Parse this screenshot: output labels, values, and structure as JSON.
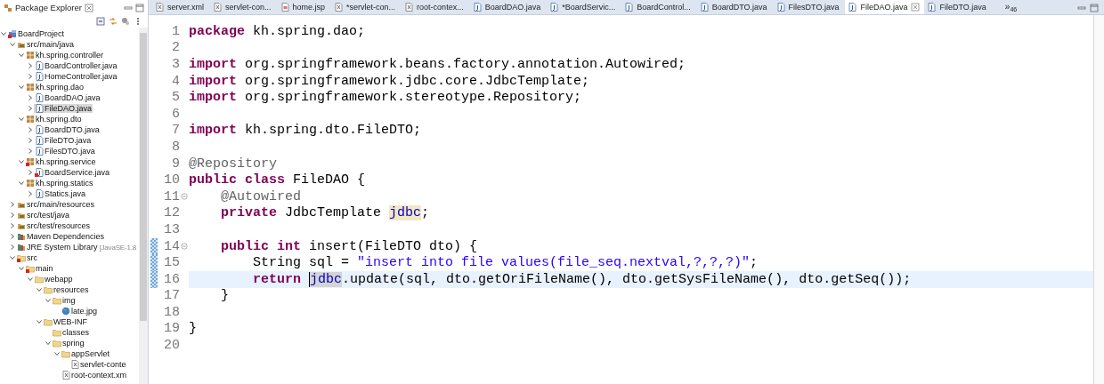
{
  "explorer": {
    "title": "Package Explorer",
    "tree": [
      {
        "label": "BoardProject",
        "kind": "project",
        "error": true,
        "expanded": true,
        "selected": false,
        "children": [
          {
            "label": "src/main/java",
            "kind": "source-folder",
            "error": false,
            "expanded": true,
            "selected": false,
            "children": [
              {
                "label": "kh.spring.controller",
                "kind": "package",
                "error": false,
                "expanded": true,
                "selected": false,
                "children": [
                  {
                    "label": "BoardController.java",
                    "kind": "java",
                    "error": false,
                    "expanded": false,
                    "selected": false
                  },
                  {
                    "label": "HomeController.java",
                    "kind": "java",
                    "error": false,
                    "expanded": false,
                    "selected": false
                  }
                ]
              },
              {
                "label": "kh.spring.dao",
                "kind": "package",
                "error": false,
                "expanded": true,
                "selected": false,
                "children": [
                  {
                    "label": "BoardDAO.java",
                    "kind": "java",
                    "error": false,
                    "expanded": false,
                    "selected": false
                  },
                  {
                    "label": "FileDAO.java",
                    "kind": "java",
                    "error": false,
                    "expanded": false,
                    "selected": true
                  }
                ]
              },
              {
                "label": "kh.spring.dto",
                "kind": "package",
                "error": false,
                "expanded": true,
                "selected": false,
                "children": [
                  {
                    "label": "BoardDTO.java",
                    "kind": "java",
                    "error": false,
                    "expanded": false,
                    "selected": false
                  },
                  {
                    "label": "FileDTO.java",
                    "kind": "java",
                    "error": false,
                    "expanded": false,
                    "selected": false
                  },
                  {
                    "label": "FilesDTO.java",
                    "kind": "java",
                    "error": false,
                    "expanded": false,
                    "selected": false
                  }
                ]
              },
              {
                "label": "kh.spring.service",
                "kind": "package",
                "error": true,
                "expanded": true,
                "selected": false,
                "children": [
                  {
                    "label": "BoardService.java",
                    "kind": "java",
                    "error": true,
                    "expanded": false,
                    "selected": false
                  }
                ]
              },
              {
                "label": "kh.spring.statics",
                "kind": "package",
                "error": false,
                "expanded": true,
                "selected": false,
                "children": [
                  {
                    "label": "Statics.java",
                    "kind": "java",
                    "error": false,
                    "expanded": false,
                    "selected": false
                  }
                ]
              }
            ]
          },
          {
            "label": "src/main/resources",
            "kind": "source-folder",
            "error": false,
            "expanded": false,
            "selected": false
          },
          {
            "label": "src/test/java",
            "kind": "source-folder",
            "error": false,
            "expanded": false,
            "selected": false
          },
          {
            "label": "src/test/resources",
            "kind": "source-folder",
            "error": false,
            "expanded": false,
            "selected": false
          },
          {
            "label": "Maven Dependencies",
            "kind": "library",
            "error": false,
            "expanded": false,
            "selected": false
          },
          {
            "label": "JRE System Library",
            "note": "[JavaSE-1.8",
            "kind": "library",
            "error": false,
            "expanded": false,
            "selected": false
          },
          {
            "label": "src",
            "kind": "folder",
            "error": true,
            "expanded": true,
            "selected": false,
            "children": [
              {
                "label": "main",
                "kind": "folder",
                "error": true,
                "expanded": true,
                "selected": false,
                "children": [
                  {
                    "label": "webapp",
                    "kind": "folder",
                    "error": false,
                    "expanded": true,
                    "selected": false,
                    "children": [
                      {
                        "label": "resources",
                        "kind": "folder",
                        "error": false,
                        "expanded": true,
                        "selected": false,
                        "children": [
                          {
                            "label": "img",
                            "kind": "folder",
                            "error": false,
                            "expanded": true,
                            "selected": false,
                            "children": [
                              {
                                "label": "late.jpg",
                                "kind": "image",
                                "error": false,
                                "selected": false
                              }
                            ]
                          }
                        ]
                      },
                      {
                        "label": "WEB-INF",
                        "kind": "folder",
                        "error": false,
                        "expanded": true,
                        "selected": false,
                        "children": [
                          {
                            "label": "classes",
                            "kind": "folder",
                            "error": false,
                            "selected": false
                          },
                          {
                            "label": "spring",
                            "kind": "folder",
                            "error": false,
                            "expanded": true,
                            "selected": false,
                            "children": [
                              {
                                "label": "appServlet",
                                "kind": "folder",
                                "error": false,
                                "expanded": true,
                                "selected": false,
                                "children": [
                                  {
                                    "label": "servlet-conte",
                                    "kind": "xml",
                                    "error": false,
                                    "selected": false
                                  }
                                ]
                              },
                              {
                                "label": "root-context.xm",
                                "kind": "xml",
                                "error": false,
                                "selected": false
                              }
                            ]
                          }
                        ]
                      }
                    ]
                  }
                ]
              }
            ]
          }
        ]
      }
    ]
  },
  "editor": {
    "tabs": [
      {
        "label": "server.xml",
        "kind": "xml",
        "selected": false
      },
      {
        "label": "servlet-con...",
        "kind": "xml",
        "selected": false
      },
      {
        "label": "home.jsp",
        "kind": "jsp",
        "selected": false
      },
      {
        "label": "*servlet-con...",
        "kind": "xml",
        "selected": false
      },
      {
        "label": "root-contex...",
        "kind": "xml",
        "selected": false
      },
      {
        "label": "BoardDAO.java",
        "kind": "java",
        "selected": false
      },
      {
        "label": "*BoardServic...",
        "kind": "java",
        "selected": false
      },
      {
        "label": "BoardControl...",
        "kind": "java",
        "selected": false
      },
      {
        "label": "BoardDTO.java",
        "kind": "java",
        "selected": false
      },
      {
        "label": "FilesDTO.java",
        "kind": "java",
        "selected": false
      },
      {
        "label": "FileDAO.java",
        "kind": "java",
        "selected": true
      },
      {
        "label": "FileDTO.java",
        "kind": "java",
        "selected": false
      }
    ],
    "overflow": {
      "chevron": "»",
      "count": "46"
    },
    "lines": [
      {
        "number": "1",
        "current": false,
        "changed": false,
        "tokens": [
          {
            "kind": "keyword",
            "text": "package"
          },
          {
            "kind": "text",
            "text": " kh.spring.dao;"
          }
        ]
      },
      {
        "number": "2",
        "current": false,
        "changed": false
      },
      {
        "number": "3",
        "current": false,
        "changed": false,
        "tokens": [
          {
            "kind": "keyword",
            "text": "import"
          },
          {
            "kind": "text",
            "text": " org.springframework.beans.factory.annotation.Autowired;"
          }
        ]
      },
      {
        "number": "4",
        "current": false,
        "changed": false,
        "tokens": [
          {
            "kind": "keyword",
            "text": "import"
          },
          {
            "kind": "text",
            "text": " org.springframework.jdbc.core.JdbcTemplate;"
          }
        ]
      },
      {
        "number": "5",
        "current": false,
        "changed": false,
        "tokens": [
          {
            "kind": "keyword",
            "text": "import"
          },
          {
            "kind": "text",
            "text": " org.springframework.stereotype.Repository;"
          }
        ]
      },
      {
        "number": "6",
        "current": false,
        "changed": false
      },
      {
        "number": "7",
        "current": false,
        "changed": false,
        "tokens": [
          {
            "kind": "keyword",
            "text": "import"
          },
          {
            "kind": "text",
            "text": " kh.spring.dto.FileDTO;"
          }
        ]
      },
      {
        "number": "8",
        "current": false,
        "changed": false
      },
      {
        "number": "9",
        "current": false,
        "changed": false,
        "tokens": [
          {
            "kind": "annotation",
            "text": "@Repository"
          }
        ]
      },
      {
        "number": "10",
        "current": false,
        "changed": false,
        "tokens": [
          {
            "kind": "keyword",
            "text": "public class"
          },
          {
            "kind": "text",
            "text": " FileDAO {"
          }
        ]
      },
      {
        "number": "11",
        "current": false,
        "changed": false,
        "fold": true,
        "tokens": [
          {
            "kind": "annotation",
            "text": "    @Autowired"
          }
        ]
      },
      {
        "number": "12",
        "current": false,
        "changed": false,
        "tokens": [
          {
            "kind": "keyword",
            "text": "    private"
          },
          {
            "kind": "text",
            "text": " JdbcTemplate "
          },
          {
            "kind": "field",
            "text": "jdbc",
            "highlighted": true,
            "write": true
          },
          {
            "kind": "text",
            "text": ";"
          }
        ]
      },
      {
        "number": "13",
        "current": false,
        "changed": false
      },
      {
        "number": "14",
        "current": false,
        "changed": true,
        "fold": true,
        "tokens": [
          {
            "kind": "keyword",
            "text": "    public int"
          },
          {
            "kind": "text",
            "text": " insert(FileDTO dto) {"
          }
        ]
      },
      {
        "number": "15",
        "current": false,
        "changed": true,
        "tokens": [
          {
            "kind": "text",
            "text": "        String sql = "
          },
          {
            "kind": "string",
            "text": "\"insert into file values(file_seq.nextval,?,?,?)\""
          },
          {
            "kind": "text",
            "text": ";"
          }
        ]
      },
      {
        "number": "16",
        "current": true,
        "changed": true,
        "tokens": [
          {
            "kind": "keyword",
            "text": "        return "
          },
          {
            "kind": "field",
            "text": "jdbc",
            "highlighted": true,
            "write": false,
            "caret": true
          },
          {
            "kind": "text",
            "text": ".update(sql, dto.getOriFileName(), dto.getSysFileName(), dto.getSeq());"
          }
        ]
      },
      {
        "number": "17",
        "current": false,
        "changed": false,
        "tokens": [
          {
            "kind": "text",
            "text": "    }"
          }
        ]
      },
      {
        "number": "18",
        "current": false,
        "changed": false
      },
      {
        "number": "19",
        "current": false,
        "changed": false,
        "tokens": [
          {
            "kind": "text",
            "text": "}"
          }
        ]
      },
      {
        "number": "20",
        "current": false,
        "changed": false
      }
    ]
  }
}
